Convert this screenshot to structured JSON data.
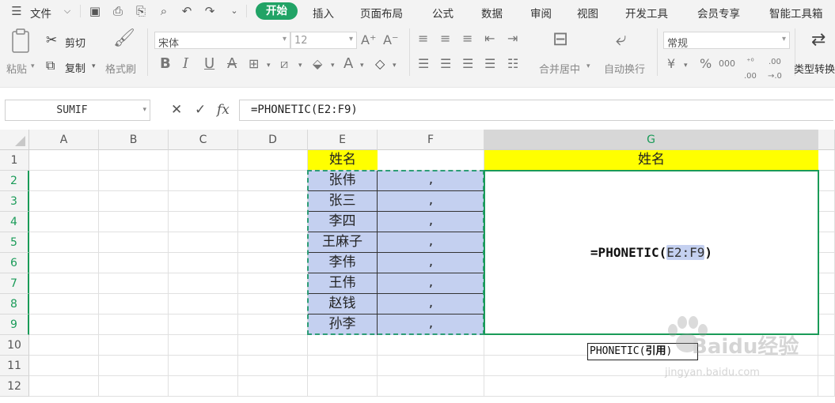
{
  "menu": {
    "file": "文件",
    "tabs": [
      "开始",
      "插入",
      "页面布局",
      "公式",
      "数据",
      "审阅",
      "视图",
      "开发工具",
      "会员专享",
      "智能工具箱"
    ]
  },
  "ribbon": {
    "paste": "粘贴",
    "cut": "剪切",
    "copy": "复制",
    "format_painter": "格式刷",
    "font_name": "宋体",
    "font_size": "12",
    "merge_center": "合并居中",
    "wrap_text": "自动换行",
    "number_format": "常规",
    "convert_type": "类型转换"
  },
  "formula_bar": {
    "name_box": "SUMIF",
    "fx_label": "fx",
    "formula": "=PHONETIC(E2:F9)"
  },
  "columns": [
    "A",
    "B",
    "C",
    "D",
    "E",
    "F",
    "G"
  ],
  "rows": [
    "1",
    "2",
    "3",
    "4",
    "5",
    "6",
    "7",
    "8",
    "9",
    "10",
    "11",
    "12"
  ],
  "cells": {
    "E1": "姓名",
    "G1": "姓名",
    "names": [
      "张伟",
      "张三",
      "李四",
      "王麻子",
      "李伟",
      "王伟",
      "赵钱",
      "孙李"
    ],
    "commas": [
      ",",
      ",",
      ",",
      ",",
      ",",
      ",",
      ",",
      ","
    ],
    "G_editing_prefix": "=PHONETIC(",
    "G_editing_ref": "E2:F9",
    "G_editing_suffix": ")"
  },
  "tooltip": {
    "fn": "PHONETIC",
    "open_paren": "(",
    "arg": "引用",
    "close_paren": ")"
  },
  "watermark": {
    "brand": "Baidu经验",
    "url": "jingyan.baidu.com"
  },
  "colors": {
    "accent_green": "#21a366",
    "header_yellow": "#ffff00",
    "range_blue": "#c4d0f0"
  }
}
